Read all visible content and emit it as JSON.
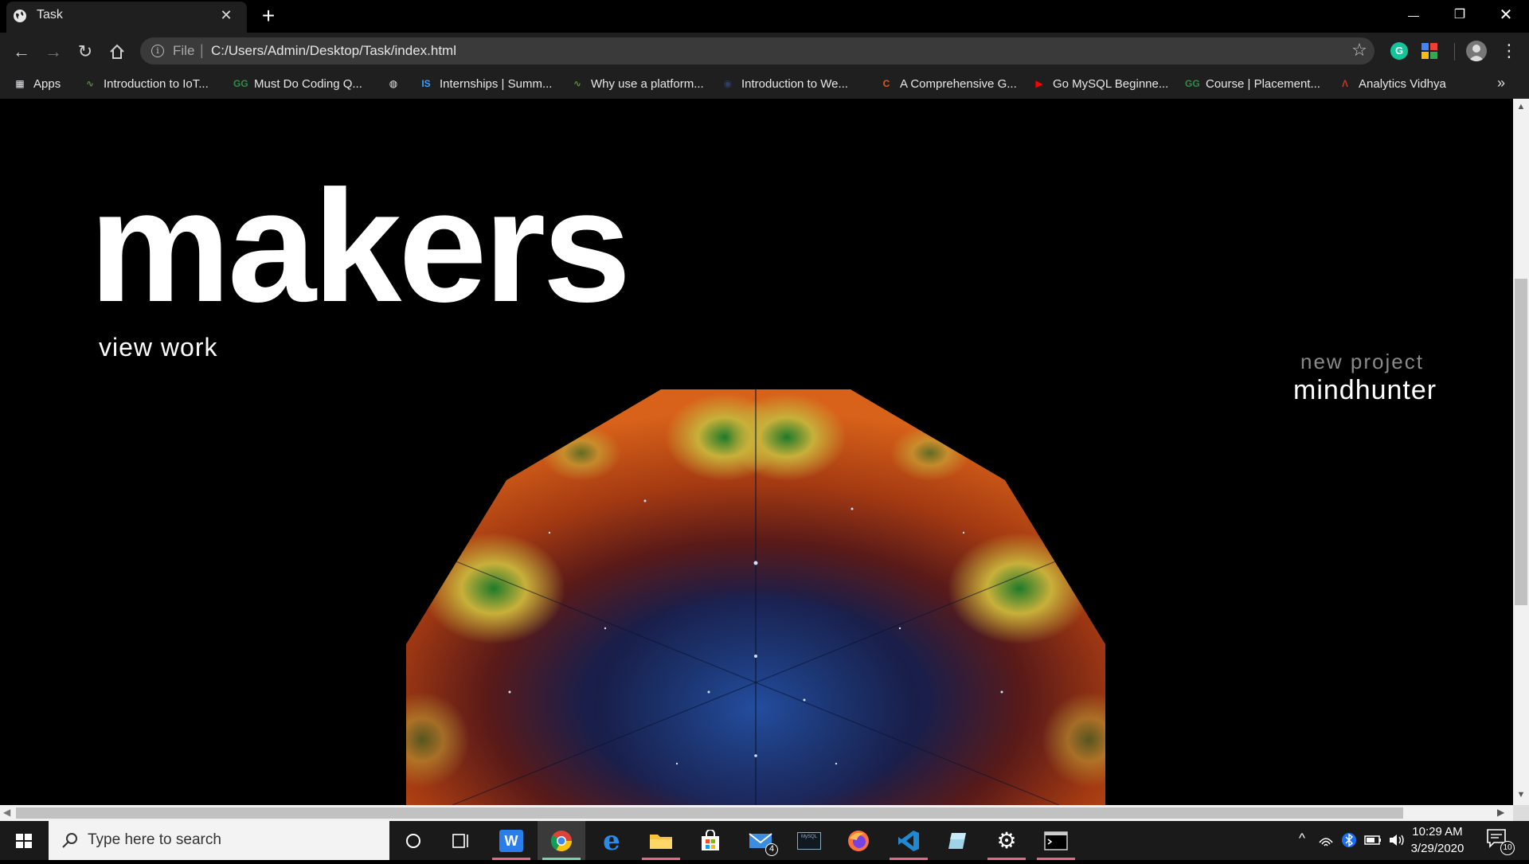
{
  "browser": {
    "tab": {
      "title": "Task",
      "close": "✕"
    },
    "new_tab": "+",
    "window": {
      "minimize": "—",
      "restore": "❐",
      "close": "✕"
    },
    "toolbar": {
      "scheme": "File",
      "separator": "|",
      "url": "C:/Users/Admin/Desktop/Task/index.html",
      "grammarly_letter": "G"
    },
    "bookmarks": [
      {
        "label": "Apps",
        "icon": "apps-grid-icon",
        "color": "#e8eaed"
      },
      {
        "label": "Introduction to IoT...",
        "icon": "waveform-icon",
        "color": "#5a8f3c"
      },
      {
        "label": "Must Do Coding Q...",
        "icon": "geeksforgeeks-icon",
        "color": "#2f8d46"
      },
      {
        "label": "",
        "icon": "globe-icon",
        "color": "#e8eaed"
      },
      {
        "label": "Internships | Summ...",
        "icon": "internshala-icon",
        "color": "#3aa0ff"
      },
      {
        "label": "Why use a platform...",
        "icon": "waveform-icon",
        "color": "#5a8f3c"
      },
      {
        "label": "Introduction to We...",
        "icon": "course-icon",
        "color": "#2c3e66"
      },
      {
        "label": "A Comprehensive G...",
        "icon": "circle-c-icon",
        "color": "#e05a1c"
      },
      {
        "label": "Go MySQL Beginne...",
        "icon": "youtube-icon",
        "color": "#ff0000"
      },
      {
        "label": "Course | Placement...",
        "icon": "geeksforgeeks-icon",
        "color": "#2f8d46"
      },
      {
        "label": "Analytics Vidhya",
        "icon": "analytics-vidhya-icon",
        "color": "#c0392b"
      }
    ],
    "bookmarks_more": "»"
  },
  "page": {
    "hero_title": "makers",
    "view_work": "view work",
    "new_project_label": "new project",
    "new_project_name": "mindhunter"
  },
  "taskbar": {
    "search_placeholder": "Type here to search",
    "mail_badge": "4",
    "time": "10:29 AM",
    "date": "3/29/2020",
    "notifications": "10"
  },
  "colors": {
    "chrome_bg": "#1f1f1f",
    "page_bg": "#000000",
    "taskbar_bg": "#1a1a1a"
  }
}
